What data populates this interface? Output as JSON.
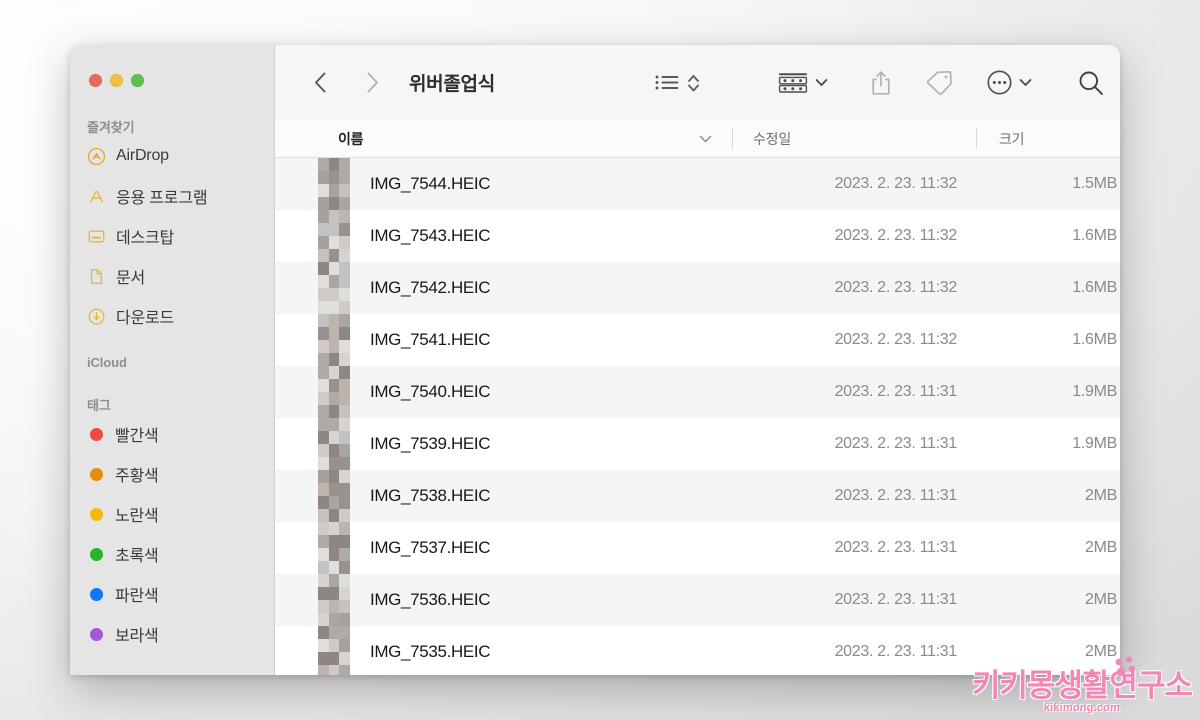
{
  "window": {
    "title": "위버졸업식",
    "traffic_lights": [
      {
        "name": "close",
        "color": "#e8695e"
      },
      {
        "name": "minimize",
        "color": "#f0be42"
      },
      {
        "name": "zoom",
        "color": "#5bc14d"
      }
    ]
  },
  "toolbar": {
    "back_icon": "chevron-left-icon",
    "forward_icon": "chevron-right-icon",
    "view_list_icon": "list-view-icon",
    "view_chevron_icon": "chevron-updown-icon",
    "group_icon": "group-by-icon",
    "group_chevron_icon": "chevron-down-icon",
    "share_icon": "share-icon",
    "tag_icon": "tag-icon",
    "more_icon": "more-ellipsis-icon",
    "more_chevron_icon": "chevron-down-icon",
    "search_icon": "search-icon"
  },
  "sidebar": {
    "favorites_label": "즐겨찾기",
    "favorites": [
      {
        "label": "AirDrop",
        "icon": "airdrop-icon"
      },
      {
        "label": "응용 프로그램",
        "icon": "applications-icon"
      },
      {
        "label": "데스크탑",
        "icon": "desktop-icon"
      },
      {
        "label": "문서",
        "icon": "documents-icon"
      },
      {
        "label": "다운로드",
        "icon": "downloads-icon"
      }
    ],
    "icloud_label": "iCloud",
    "tags_label": "태그",
    "tags": [
      {
        "label": "빨간색",
        "color": "#f24a42"
      },
      {
        "label": "주황색",
        "color": "#e88a0c"
      },
      {
        "label": "노란색",
        "color": "#f0b90b"
      },
      {
        "label": "초록색",
        "color": "#28b32a"
      },
      {
        "label": "파란색",
        "color": "#1277f5"
      },
      {
        "label": "보라색",
        "color": "#a657d8"
      }
    ]
  },
  "columns": {
    "name": "이름",
    "date_modified": "수정일",
    "size": "크기",
    "sort_chevron_icon": "chevron-down-icon"
  },
  "files": [
    {
      "name": "IMG_7544.HEIC",
      "date": "2023. 2. 23. 11:32",
      "size": "1.5MB"
    },
    {
      "name": "IMG_7543.HEIC",
      "date": "2023. 2. 23. 11:32",
      "size": "1.6MB"
    },
    {
      "name": "IMG_7542.HEIC",
      "date": "2023. 2. 23. 11:32",
      "size": "1.6MB"
    },
    {
      "name": "IMG_7541.HEIC",
      "date": "2023. 2. 23. 11:32",
      "size": "1.6MB"
    },
    {
      "name": "IMG_7540.HEIC",
      "date": "2023. 2. 23. 11:31",
      "size": "1.9MB"
    },
    {
      "name": "IMG_7539.HEIC",
      "date": "2023. 2. 23. 11:31",
      "size": "1.9MB"
    },
    {
      "name": "IMG_7538.HEIC",
      "date": "2023. 2. 23. 11:31",
      "size": "2MB"
    },
    {
      "name": "IMG_7537.HEIC",
      "date": "2023. 2. 23. 11:31",
      "size": "2MB"
    },
    {
      "name": "IMG_7536.HEIC",
      "date": "2023. 2. 23. 11:31",
      "size": "2MB"
    },
    {
      "name": "IMG_7535.HEIC",
      "date": "2023. 2. 23. 11:31",
      "size": "2MB"
    }
  ],
  "watermark": {
    "main": "키키몽생활연구소",
    "sub": "kikimong.com",
    "color": "#f386b4"
  }
}
